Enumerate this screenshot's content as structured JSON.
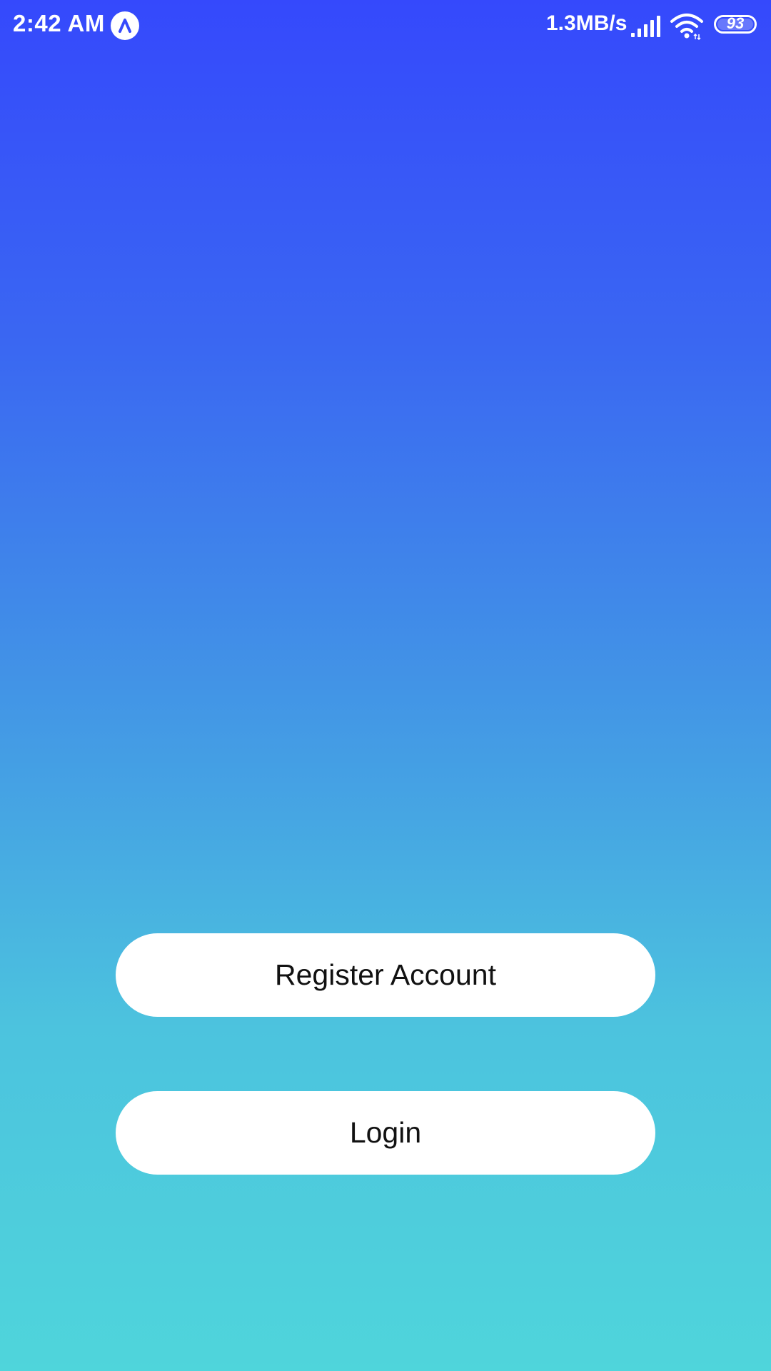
{
  "status_bar": {
    "time": "2:42 AM",
    "app_badge_icon": "caret-up-icon",
    "network_speed": "1.3MB/s",
    "signal_icon": "cellular-signal-icon",
    "wifi_icon": "wifi-icon",
    "battery_level": "93"
  },
  "colors": {
    "gradient_top": "#3549fc",
    "gradient_bottom": "#4fd5db",
    "button_background": "#ffffff",
    "button_text": "#111111"
  },
  "actions": {
    "register_label": "Register Account",
    "login_label": "Login"
  }
}
